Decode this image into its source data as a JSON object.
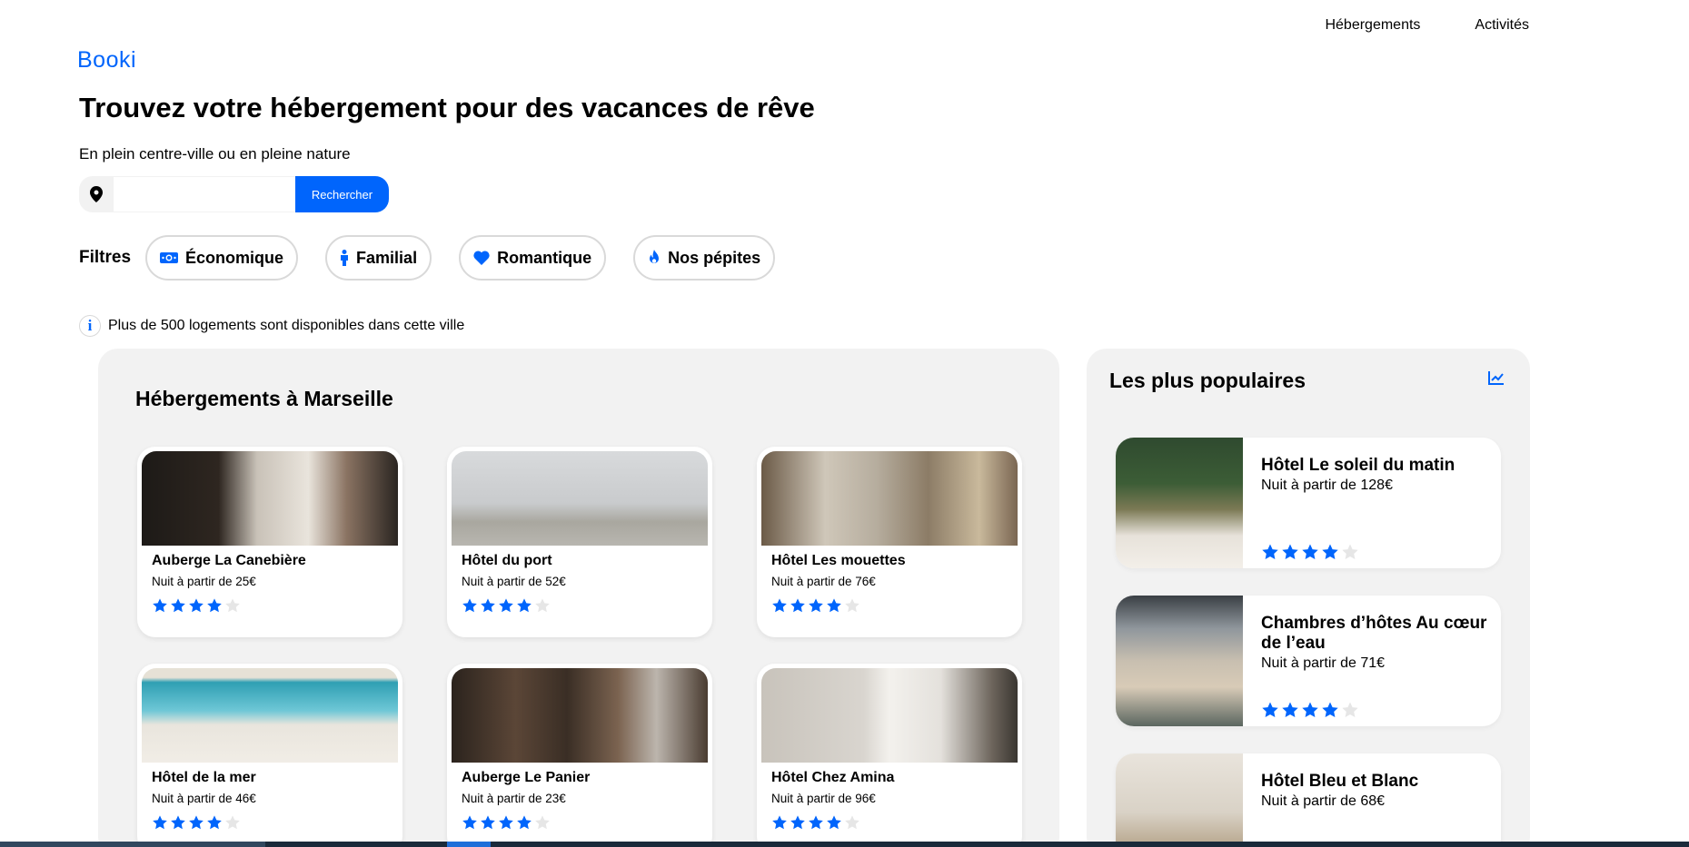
{
  "header": {
    "logo": "Booki",
    "nav": [
      "Hébergements",
      "Activités"
    ]
  },
  "hero": {
    "title": "Trouvez votre hébergement pour des vacances de rêve",
    "subtitle": "En plein centre-ville ou en pleine nature"
  },
  "search": {
    "placeholder": "",
    "value": "",
    "button_label": "Rechercher",
    "icon": "location-pin-icon"
  },
  "filters": {
    "label": "Filtres",
    "items": [
      {
        "label": "Économique",
        "icon": "money-icon"
      },
      {
        "label": "Familial",
        "icon": "child-icon"
      },
      {
        "label": "Romantique",
        "icon": "heart-icon"
      },
      {
        "label": "Nos pépites",
        "icon": "fire-icon"
      }
    ]
  },
  "info": {
    "text": "Plus de 500 logements sont disponibles dans cette ville"
  },
  "accommodations": {
    "title": "Hébergements à Marseille",
    "items": [
      {
        "name": "Auberge La Canebière",
        "price": "Nuit à partir de 25€",
        "rating": 4
      },
      {
        "name": "Hôtel du port",
        "price": "Nuit à partir de 52€",
        "rating": 4
      },
      {
        "name": "Hôtel Les mouettes",
        "price": "Nuit à partir de 76€",
        "rating": 4
      },
      {
        "name": "Hôtel de la mer",
        "price": "Nuit à partir de 46€",
        "rating": 4
      },
      {
        "name": "Auberge Le Panier",
        "price": "Nuit à partir de 23€",
        "rating": 4
      },
      {
        "name": "Hôtel Chez Amina",
        "price": "Nuit à partir de 96€",
        "rating": 4
      }
    ]
  },
  "popular": {
    "title": "Les plus populaires",
    "icon": "trend-chart-icon",
    "items": [
      {
        "name": "Hôtel Le soleil du matin",
        "price": "Nuit à partir de 128€",
        "rating": 4
      },
      {
        "name": "Chambres d’hôtes Au cœur de l’eau",
        "price": "Nuit à partir de 71€",
        "rating": 4
      },
      {
        "name": "Hôtel Bleu et Blanc",
        "price": "Nuit à partir de 68€",
        "rating": 4
      }
    ]
  },
  "colors": {
    "accent": "#0065fc",
    "panel": "#f2f2f2",
    "star_empty": "#e6e6e6"
  }
}
